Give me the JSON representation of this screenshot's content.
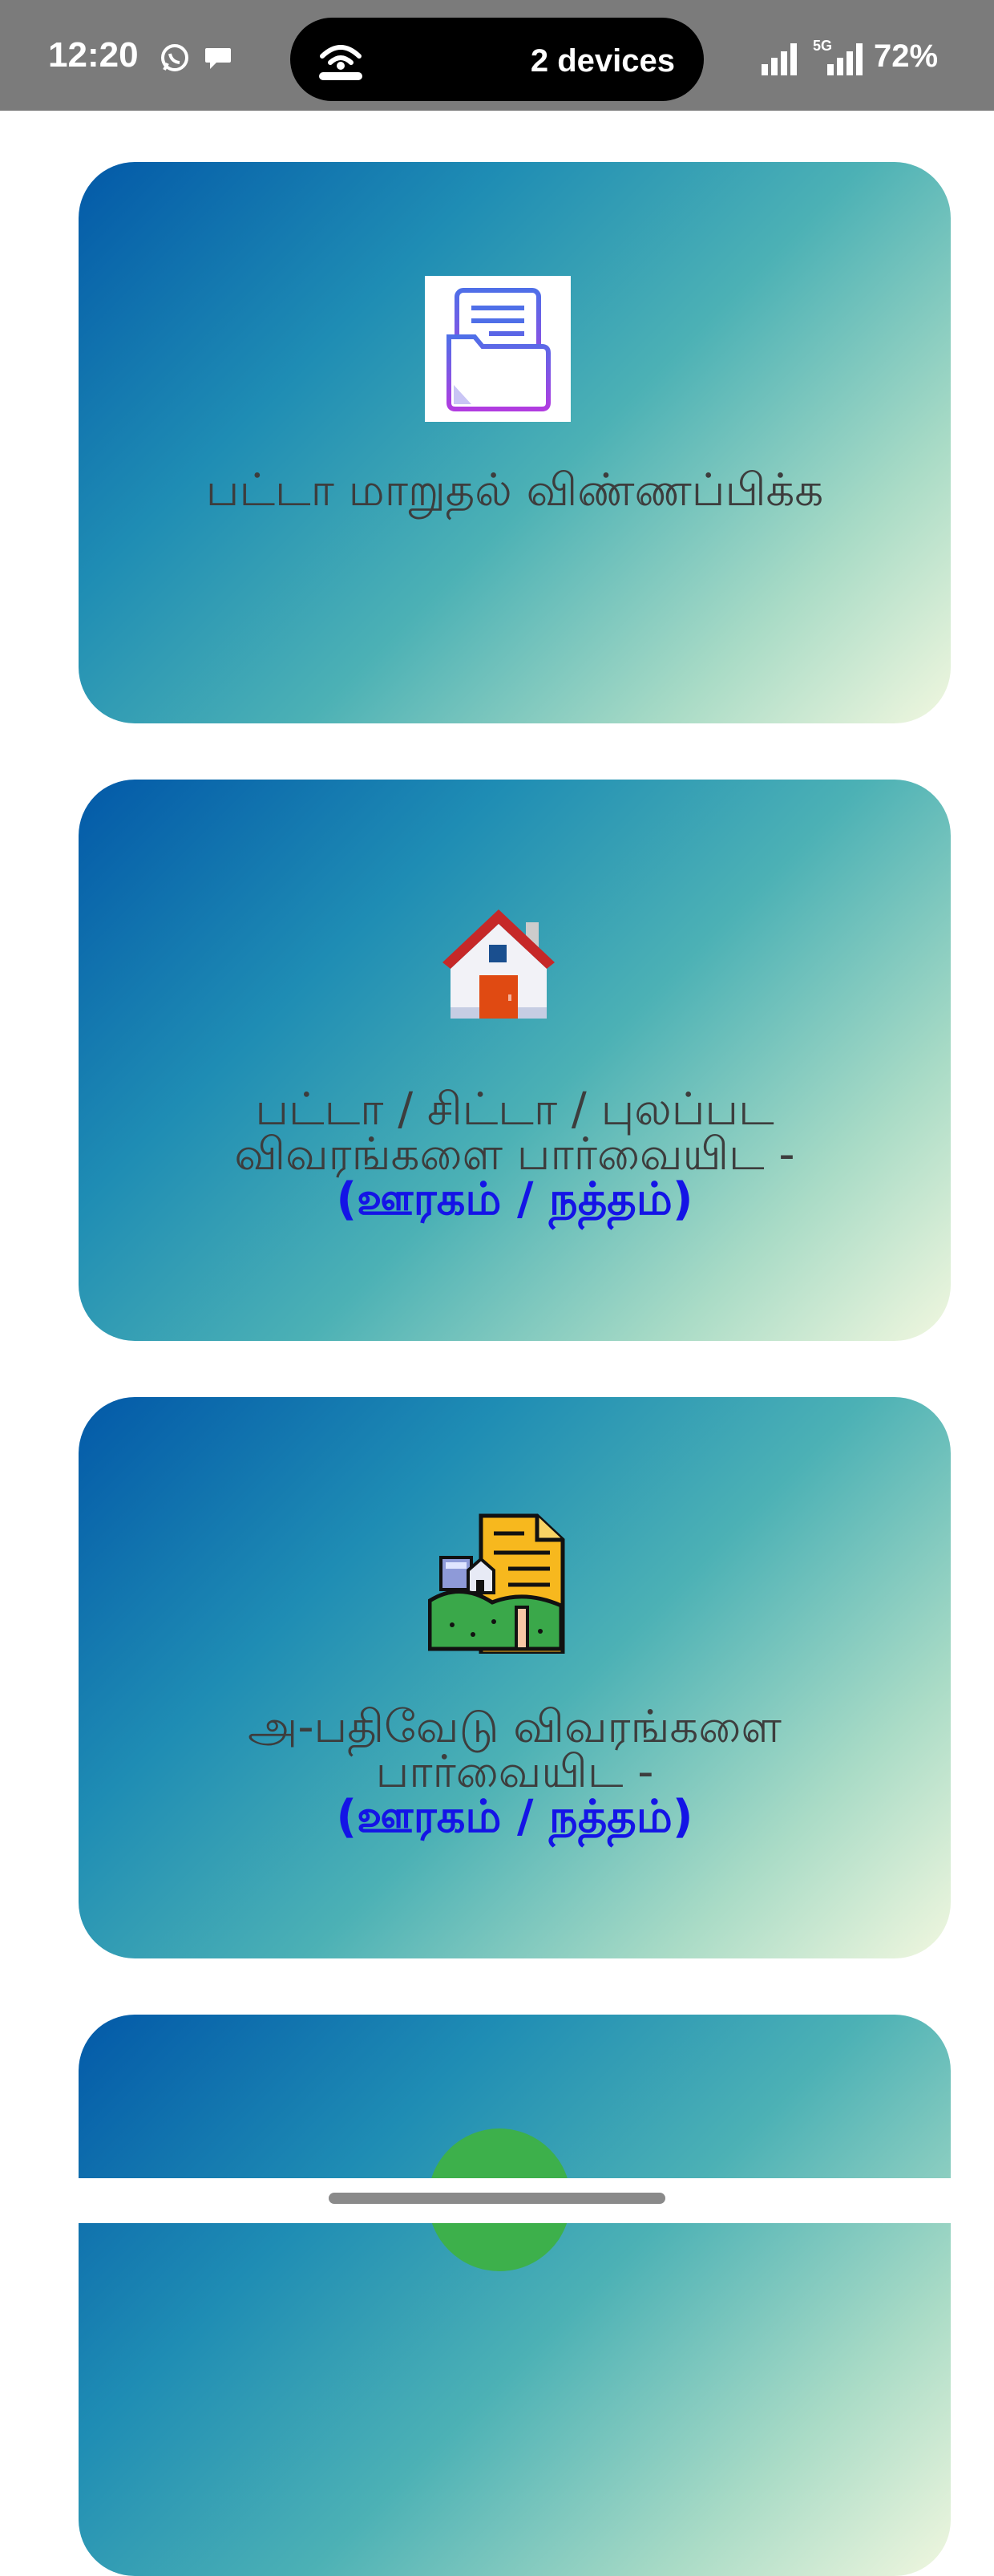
{
  "status_bar": {
    "time": "12:20",
    "notification_icons": [
      "whatsapp-icon",
      "chat-bubble-icon"
    ],
    "hotspot_pill": {
      "icon": "hotspot-icon",
      "label": "2 devices"
    },
    "network_type": "5G",
    "battery": "72%"
  },
  "cards": [
    {
      "icon": "folder-document-icon",
      "lines": [
        "பட்டா மாறுதல் விண்ணப்பிக்க"
      ],
      "link": ""
    },
    {
      "icon": "house-icon",
      "lines": [
        "பட்டா / சிட்டா / புலப்பட",
        "விவரங்களை பார்வையிட -"
      ],
      "link": "(ஊரகம் / நத்தம்)"
    },
    {
      "icon": "land-record-icon",
      "lines": [
        "அ-பதிவேடு விவரங்களை",
        "பார்வையிட -"
      ],
      "link": "(ஊரகம் / நத்தம்)"
    },
    {
      "icon": "green-circle-icon",
      "lines": [],
      "link": ""
    }
  ],
  "colors": {
    "gradient_start": "#0359a8",
    "gradient_end": "#f1f7df",
    "link_text": "#1414e6",
    "card_text": "#3d3d3d",
    "status_bar_bg": "#7b7b7b"
  }
}
